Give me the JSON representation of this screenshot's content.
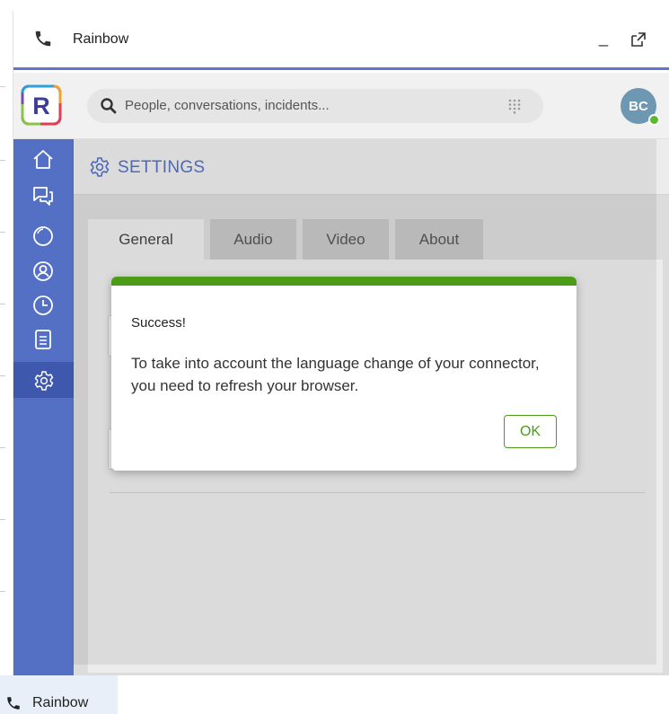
{
  "window": {
    "title": "Rainbow",
    "minimize_glyph": "_",
    "phone_icon": "phone-icon",
    "popout_icon": "popout-icon"
  },
  "search": {
    "placeholder": "People, conversations, incidents...",
    "icon": "search-icon",
    "dialpad_icon": "dialpad-icon"
  },
  "user": {
    "initials": "BC",
    "presence": "online",
    "presence_color": "#5cb82e"
  },
  "sidebar": {
    "items": [
      {
        "id": "home",
        "icon": "home-icon"
      },
      {
        "id": "conversations",
        "icon": "chat-icon"
      },
      {
        "id": "bubbles",
        "icon": "bubble-icon"
      },
      {
        "id": "contacts",
        "icon": "contact-icon"
      },
      {
        "id": "recent",
        "icon": "clock-icon"
      },
      {
        "id": "files",
        "icon": "document-icon"
      },
      {
        "id": "settings",
        "icon": "gear-icon",
        "active": true
      }
    ]
  },
  "settings": {
    "title": "SETTINGS",
    "tabs": [
      {
        "label": "General",
        "active": true
      },
      {
        "label": "Audio",
        "active": false
      },
      {
        "label": "Video",
        "active": false
      },
      {
        "label": "About",
        "active": false
      }
    ]
  },
  "dialog": {
    "title": "Success!",
    "message": "To take into account the language change of your connector, you need to refresh your browser.",
    "ok_label": "OK"
  },
  "taskbar": {
    "label": "Rainbow",
    "icon": "phone-icon"
  },
  "colors": {
    "accent": "#5470c4",
    "sidebar_active": "#3d58ac",
    "success": "#4c9c17"
  }
}
